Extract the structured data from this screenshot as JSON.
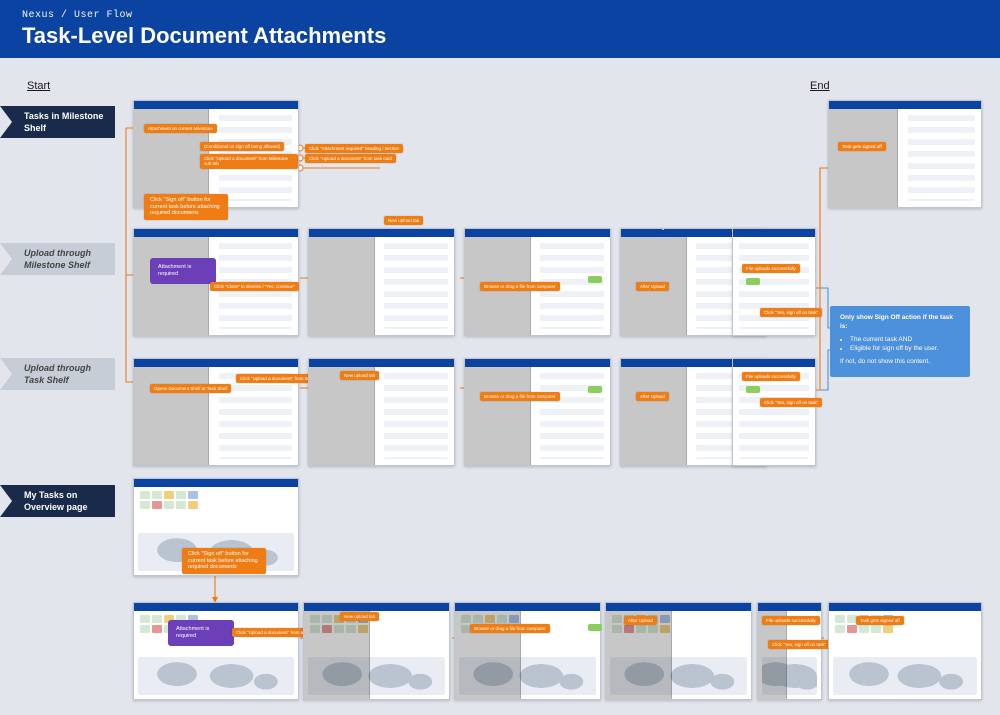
{
  "banner": {
    "breadcrumb": "Nexus / User Flow",
    "title": "Task-Level Document Attachments"
  },
  "anchors": {
    "start": "Start",
    "end": "End"
  },
  "rows": {
    "r1": "Tasks in Milestone Shelf",
    "r2": "Upload through Milestone Shelf",
    "r3": "Upload through Task Shelf",
    "r4": "My Tasks on Overview page"
  },
  "chips": {
    "c_top1": "Attachment on current Milestone",
    "c_top2": "Click \"Attachment required\" heading / section",
    "c_top3": "Click \"Upload a document\" from task card",
    "c_top4": "(Conditional on sign off being allowed)",
    "c_top5": "Click \"Upload a document\" from Milestone sub tab",
    "c_signoff_block": "Click \"Sign off\" button for current task before attaching required documents",
    "c_open_task": "Opens Document Shelf at Task Shelf",
    "c_new_upl": "New upload tab",
    "c_close_upl": "Click \"Close\" to dismiss / \"Yes, continue\"",
    "c_browse": "Browse or drag a file from computer",
    "c_after_upl": "After Upload",
    "c_upl_success": "File uploads successfully",
    "c_yes_signoff": "Click \"Yes, sign off on task\"",
    "c_task_signed": "Task gets signed off",
    "c_r3_open": "Click \"Upload a document\" from task shelf",
    "c_r3_new": "New upload tab",
    "c_r3_browse": "Browse or drag a file from computer",
    "c_r3_after": "After Upload",
    "c_r3_success": "File uploads successfully",
    "c_r3_yes": "Click \"Yes, sign off on task\"",
    "c_r4_block": "Click \"Sign off\" button for current task before attaching required documents",
    "c_r4_open": "Click \"Upload a document\" from attachment",
    "c_r4_new": "New upload tab",
    "c_r4_browse": "Browse or drag a file from computer",
    "c_r4_after": "After Upload",
    "c_r4_success": "File uploads successfully",
    "c_r4_yes": "Click \"Yes, sign off on task\"",
    "c_r4_signed": "Task gets signed off",
    "c_modal": "Attachment is required"
  },
  "info_note": {
    "heading": "Only show Sign Off action if the task is:",
    "bullets": [
      "The current task AND",
      "Eligible for sign off by the user."
    ],
    "footer": "If not, do not show this content."
  }
}
